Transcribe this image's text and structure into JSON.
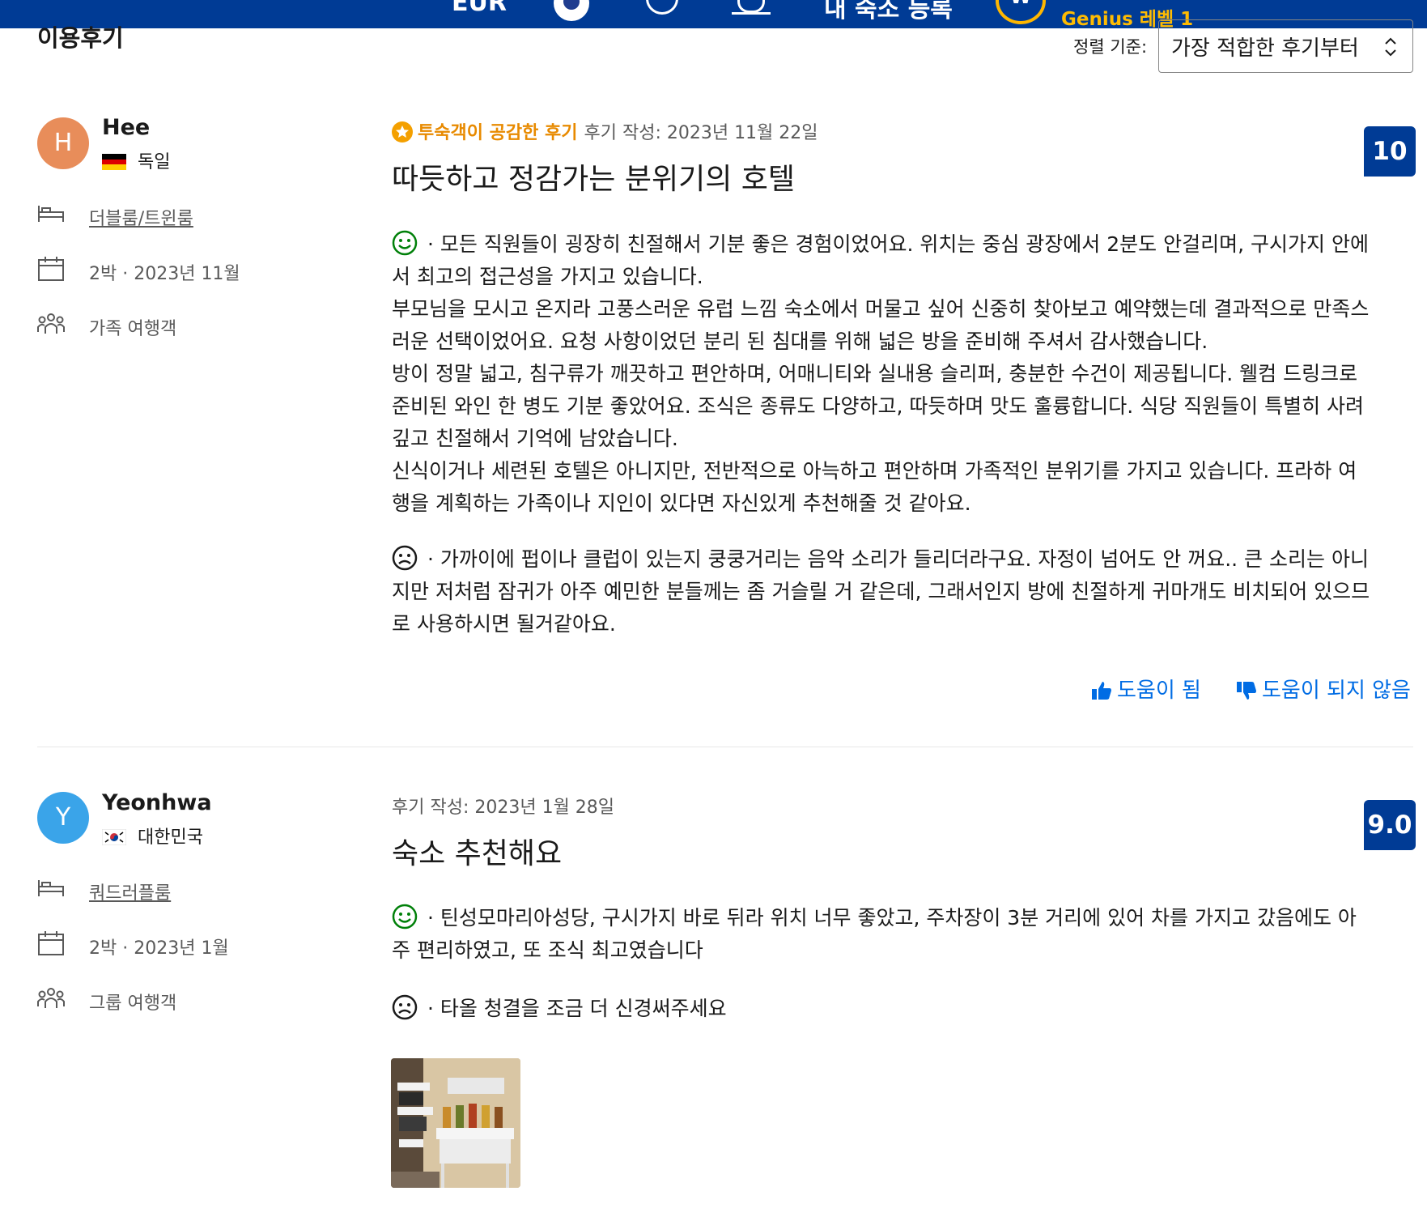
{
  "header": {
    "currency": "EUR",
    "list_property": "내 숙소 등록",
    "avatar_letter": "W",
    "genius": "Genius 레벨 1"
  },
  "section_title": "이용후기",
  "sort": {
    "label": "정렬 기준:",
    "selected": "가장 적합한 후기부터"
  },
  "reviews": [
    {
      "avatar_letter": "H",
      "avatar_color": "#e88d5a",
      "name": "Hee",
      "country": "독일",
      "room": "더블룸/트윈룸",
      "stay": "2박 ·  2023년 11월",
      "traveler": "가족 여행객",
      "badge": "투숙객이 공감한 후기",
      "date": "후기 작성: 2023년 11월 22일",
      "title": "따듯하고 정감가는 분위기의 호텔",
      "score": "10",
      "positive": [
        " · 모든 직원들이 굉장히 친절해서 기분 좋은 경험이었어요. 위치는 중심 광장에서 2분도 안걸리며, 구시가지 안에",
        "서 최고의 접근성을 가지고 있습니다.",
        "부모님을 모시고 온지라 고풍스러운 유럽 느낌 숙소에서 머물고 싶어 신중히 찾아보고 예약했는데 결과적으로 만족스",
        "러운 선택이었어요. 요청 사항이었던 분리 된 침대를 위해 넓은 방을 준비해 주셔서 감사했습니다.",
        "방이 정말 넓고, 침구류가 깨끗하고 편안하며, 어매니티와 실내용 슬리퍼, 충분한 수건이 제공됩니다. 웰컴 드링크로",
        "준비된 와인 한 병도 기분 좋았어요. 조식은 종류도 다양하고, 따듯하며 맛도 훌륭합니다. 식당 직원들이 특별히 사려",
        "깊고 친절해서 기억에 남았습니다.",
        "신식이거나 세련된 호텔은 아니지만, 전반적으로 아늑하고 편안하며 가족적인 분위기를 가지고 있습니다. 프라하 여",
        "행을 계획하는 가족이나 지인이 있다면 자신있게 추천해줄 것 같아요."
      ],
      "negative": [
        " · 가까이에 펍이나 클럽이 있는지 쿵쿵거리는 음악 소리가 들리더라구요. 자정이 넘어도 안 꺼요.. 큰 소리는 아니",
        "지만 저처럼 잠귀가 아주 예민한 분들께는 좀 거슬릴 거 같은데, 그래서인지 방에 친절하게 귀마개도 비치되어 있으므",
        "로 사용하시면 될거같아요."
      ],
      "helpful": "도움이 됨",
      "not_helpful": "도움이 되지 않음"
    },
    {
      "avatar_letter": "Y",
      "avatar_color": "#3aa4e9",
      "name": "Yeonhwa",
      "country": "대한민국",
      "room": "쿼드러플룸",
      "stay": "2박 ·  2023년 1월",
      "traveler": "그룹 여행객",
      "date": "후기 작성: 2023년 1월 28일",
      "title": "숙소 추천해요",
      "score": "9.0",
      "positive": [
        " · 틴성모마리아성당, 구시가지 바로 뒤라 위치 너무 좋았고, 주차장이 3분 거리에 있어 차를 가지고 갔음에도 아",
        "주 편리하였고, 또 조식 최고였습니다"
      ],
      "negative": [
        " · 타올 청결을 조금 더 신경써주세요"
      ]
    }
  ]
}
